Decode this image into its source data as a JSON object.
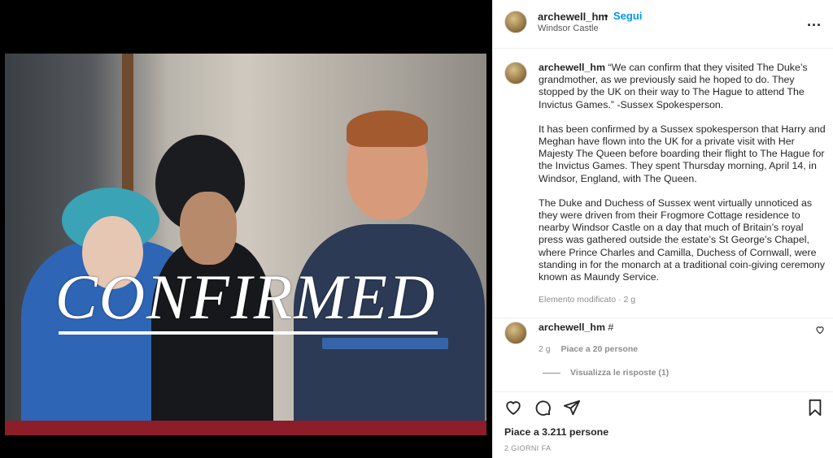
{
  "post": {
    "image_overlay_text": "CONFIRMED"
  },
  "header": {
    "username": "archewell_hm",
    "separator": "•",
    "follow_label": "Segui",
    "location": "Windsor Castle",
    "more_label": "..."
  },
  "caption": {
    "username": "archewell_hm",
    "paragraph1": "“We can confirm that they visited The Duke’s grandmother, as we previously said he hoped to do. They stopped by the UK on their way to The Hague to attend The Invictus Games.” -Sussex Spokesperson.",
    "paragraph2": "It has been confirmed by a Sussex spokesperson that Harry and Meghan have flown into the UK for a private visit with Her Majesty The Queen before boarding their flight to The Hague for the Invictus Games. They spent Thursday morning, April 14, in Windsor, England, with The Queen.",
    "paragraph3": "The Duke and Duchess of Sussex went virtually unnoticed as they were driven from their Frogmore Cottage residence to nearby Windsor Castle on a day that much of Britain’s royal press was gathered outside the estate’s St George’s Chapel, where Prince Charles and Camilla, Duchess of Cornwall, were standing in for the monarch at a traditional coin-giving ceremony known as Maundy Service.",
    "edited_label": "Elemento modificato",
    "separator": "·",
    "time": "2 g"
  },
  "comment": {
    "username": "archewell_hm",
    "text": "#",
    "time": "2 g",
    "likes": "Piace a 20 persone",
    "view_replies": "Visualizza le risposte (1)"
  },
  "actions": {
    "icons": [
      "heart-icon",
      "comment-icon",
      "share-icon",
      "bookmark-icon"
    ],
    "likes_text": "Piace a 3.211 persone",
    "date_text": "2 GIORNI FA"
  },
  "colors": {
    "accent": "#0095f6",
    "text": "#262626",
    "muted": "#8e8e8e"
  }
}
